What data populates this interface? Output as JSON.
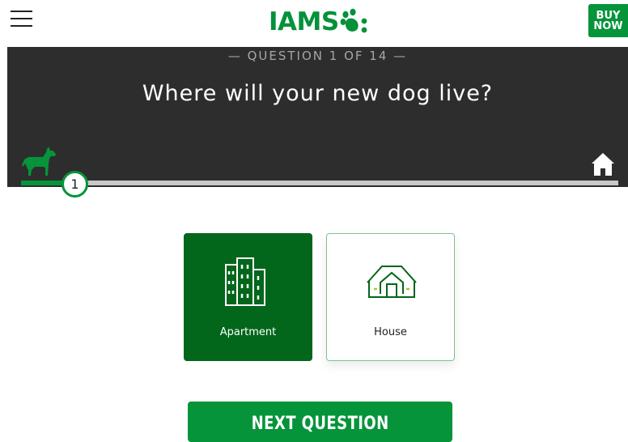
{
  "header": {
    "menu_icon": "hamburger-menu-icon",
    "logo_text": "IAMS",
    "logo_icon": "paw-icon",
    "buy_now_line1": "BUY",
    "buy_now_line2": "NOW"
  },
  "quiz": {
    "counter": "— QUESTION 1 OF 14 —",
    "question": "Where will your new dog live?",
    "step_number": "1",
    "progress_fraction": 0.07,
    "start_icon": "dog-icon",
    "end_icon": "home-icon"
  },
  "options": [
    {
      "label": "Apartment",
      "icon": "apartment-building-icon",
      "selected": true
    },
    {
      "label": "House",
      "icon": "house-icon",
      "selected": false
    }
  ],
  "next_button": {
    "label": "NEXT QUESTION"
  },
  "colors": {
    "brand_green": "#05943a",
    "selected_green": "#02661b",
    "hero_background": "#2d2d2d",
    "track_gray": "#c9c9c9"
  }
}
